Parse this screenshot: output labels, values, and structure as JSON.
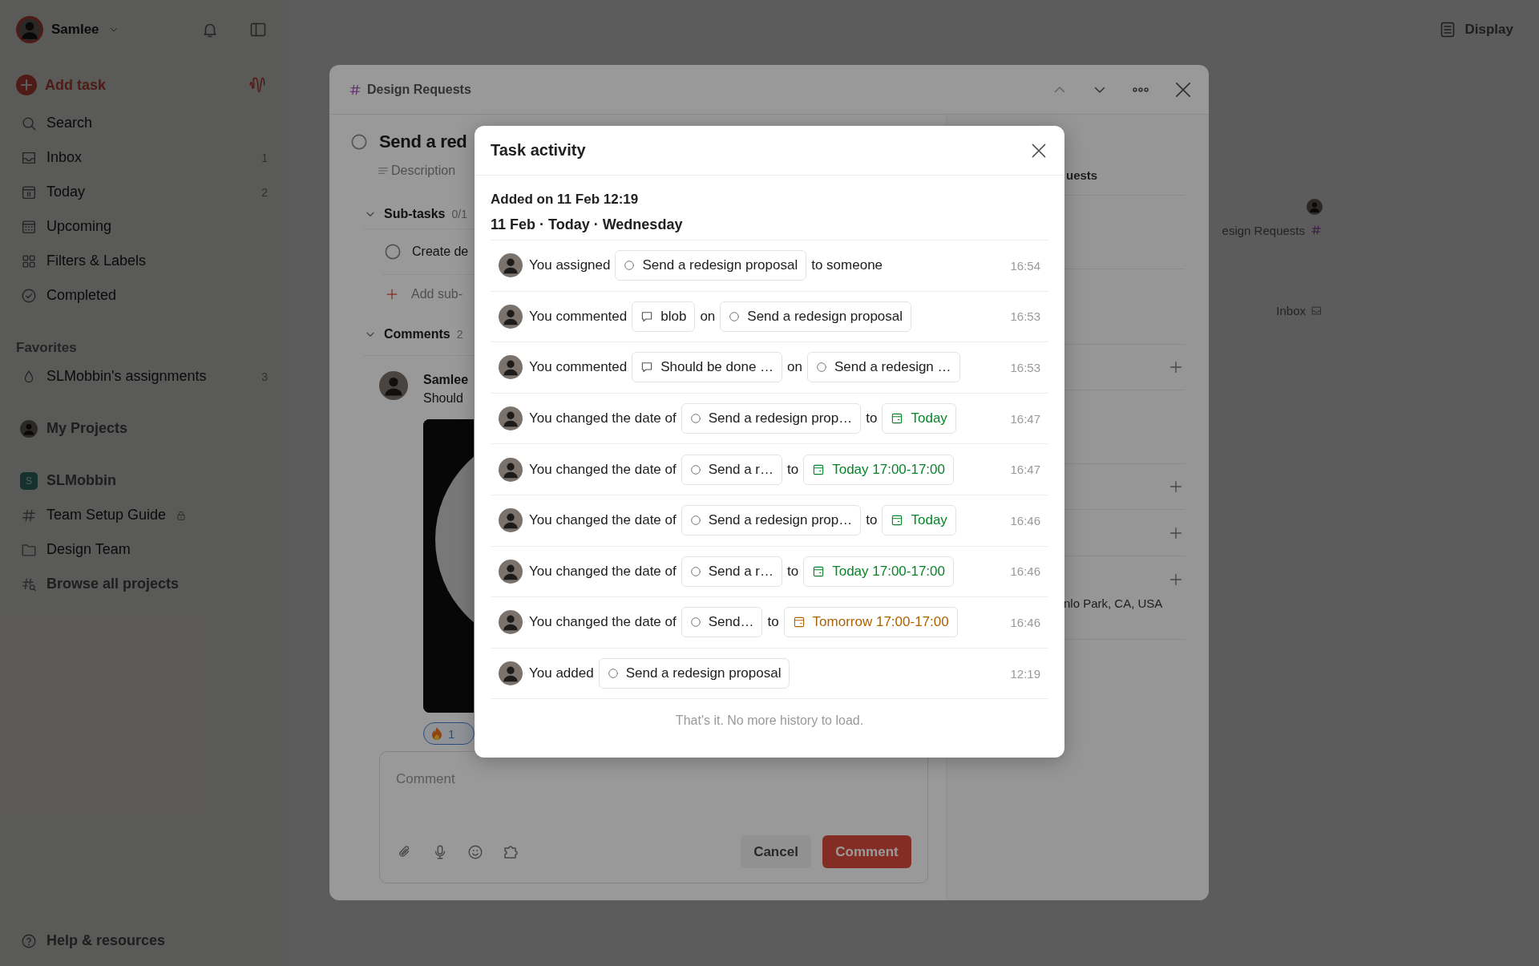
{
  "sidebar": {
    "user": {
      "name": "Samlee"
    },
    "add_task": "Add task",
    "nav": [
      {
        "kind": "search",
        "label": "Search"
      },
      {
        "kind": "inbox",
        "label": "Inbox",
        "count": "1"
      },
      {
        "kind": "today",
        "label": "Today",
        "count": "2"
      },
      {
        "kind": "upcoming",
        "label": "Upcoming"
      },
      {
        "kind": "filters",
        "label": "Filters & Labels"
      },
      {
        "kind": "completed",
        "label": "Completed"
      }
    ],
    "favorites": {
      "title": "Favorites",
      "items": [
        {
          "label": "SLMobbin's assignments",
          "count": "3"
        }
      ]
    },
    "my_projects": "My Projects",
    "workspace": {
      "name": "SLMobbin",
      "badge": "S",
      "projects": [
        {
          "kind": "project",
          "label": "Team Setup Guide",
          "locked": true
        },
        {
          "kind": "folder",
          "label": "Design Team",
          "locked": false
        },
        {
          "kind": "browse",
          "label": "Browse all projects",
          "locked": false
        }
      ]
    },
    "help": "Help & resources"
  },
  "toolbar": {
    "display": "Display"
  },
  "background_list": {
    "rows": [
      {
        "kind": "project",
        "text": "esign Requests"
      },
      {
        "kind": "inbox",
        "text": "Inbox"
      }
    ]
  },
  "task_window": {
    "project": "Design Requests",
    "title": "Send a red",
    "description_placeholder": "Description",
    "subtasks": {
      "title": "Sub-tasks",
      "count": "0/1",
      "items": [
        {
          "title": "Create de"
        }
      ],
      "add": "Add sub-"
    },
    "comments": {
      "title": "Comments",
      "count": "2",
      "items": [
        {
          "author": "Samlee",
          "text": "Should",
          "reactions": [
            {
              "count": "1"
            }
          ]
        }
      ]
    },
    "comment_field": {
      "placeholder": "Comment"
    },
    "buttons": {
      "cancel": "Cancel",
      "submit": "Comment"
    },
    "side_panel": {
      "project": "uests",
      "location": "nlo Park, CA, USA"
    }
  },
  "activity": {
    "title": "Task activity",
    "added": "Added on 11 Feb 12:19",
    "day": "11 Feb · Today · Wednesday",
    "rows": [
      {
        "parts": [
          {
            "kind": "text",
            "text": "You assigned"
          },
          {
            "kind": "task",
            "text": "Send a redesign proposal"
          },
          {
            "kind": "text",
            "text": "to someone"
          }
        ],
        "time": "16:54"
      },
      {
        "parts": [
          {
            "kind": "text",
            "text": "You commented"
          },
          {
            "kind": "comment",
            "text": "blob"
          },
          {
            "kind": "text",
            "text": "on"
          },
          {
            "kind": "task",
            "text": "Send a redesign proposal"
          }
        ],
        "time": "16:53"
      },
      {
        "parts": [
          {
            "kind": "text",
            "text": "You commented"
          },
          {
            "kind": "comment",
            "text": "Should be done …"
          },
          {
            "kind": "text",
            "text": "on"
          },
          {
            "kind": "task",
            "text": "Send a redesign …"
          }
        ],
        "time": "16:53"
      },
      {
        "parts": [
          {
            "kind": "text",
            "text": "You changed the date of"
          },
          {
            "kind": "task",
            "text": "Send a redesign prop…"
          },
          {
            "kind": "text",
            "text": "to"
          },
          {
            "kind": "date",
            "text": "Today",
            "color": "#058527"
          }
        ],
        "time": "16:47"
      },
      {
        "parts": [
          {
            "kind": "text",
            "text": "You changed the date of"
          },
          {
            "kind": "task",
            "text": "Send a r…"
          },
          {
            "kind": "text",
            "text": "to"
          },
          {
            "kind": "date",
            "text": "Today 17:00-17:00",
            "color": "#058527"
          }
        ],
        "time": "16:47"
      },
      {
        "parts": [
          {
            "kind": "text",
            "text": "You changed the date of"
          },
          {
            "kind": "task",
            "text": "Send a redesign prop…"
          },
          {
            "kind": "text",
            "text": "to"
          },
          {
            "kind": "date",
            "text": "Today",
            "color": "#058527"
          }
        ],
        "time": "16:46"
      },
      {
        "parts": [
          {
            "kind": "text",
            "text": "You changed the date of"
          },
          {
            "kind": "task",
            "text": "Send a r…"
          },
          {
            "kind": "text",
            "text": "to"
          },
          {
            "kind": "date",
            "text": "Today 17:00-17:00",
            "color": "#058527"
          }
        ],
        "time": "16:46"
      },
      {
        "parts": [
          {
            "kind": "text",
            "text": "You changed the date of"
          },
          {
            "kind": "task",
            "text": "Send…"
          },
          {
            "kind": "text",
            "text": "to"
          },
          {
            "kind": "date",
            "text": "Tomorrow 17:00-17:00",
            "color": "#ad6200"
          }
        ],
        "time": "16:46"
      },
      {
        "parts": [
          {
            "kind": "text",
            "text": "You added"
          },
          {
            "kind": "task",
            "text": "Send a redesign proposal"
          }
        ],
        "time": "12:19"
      }
    ],
    "footer": "That's it. No more history to load."
  }
}
